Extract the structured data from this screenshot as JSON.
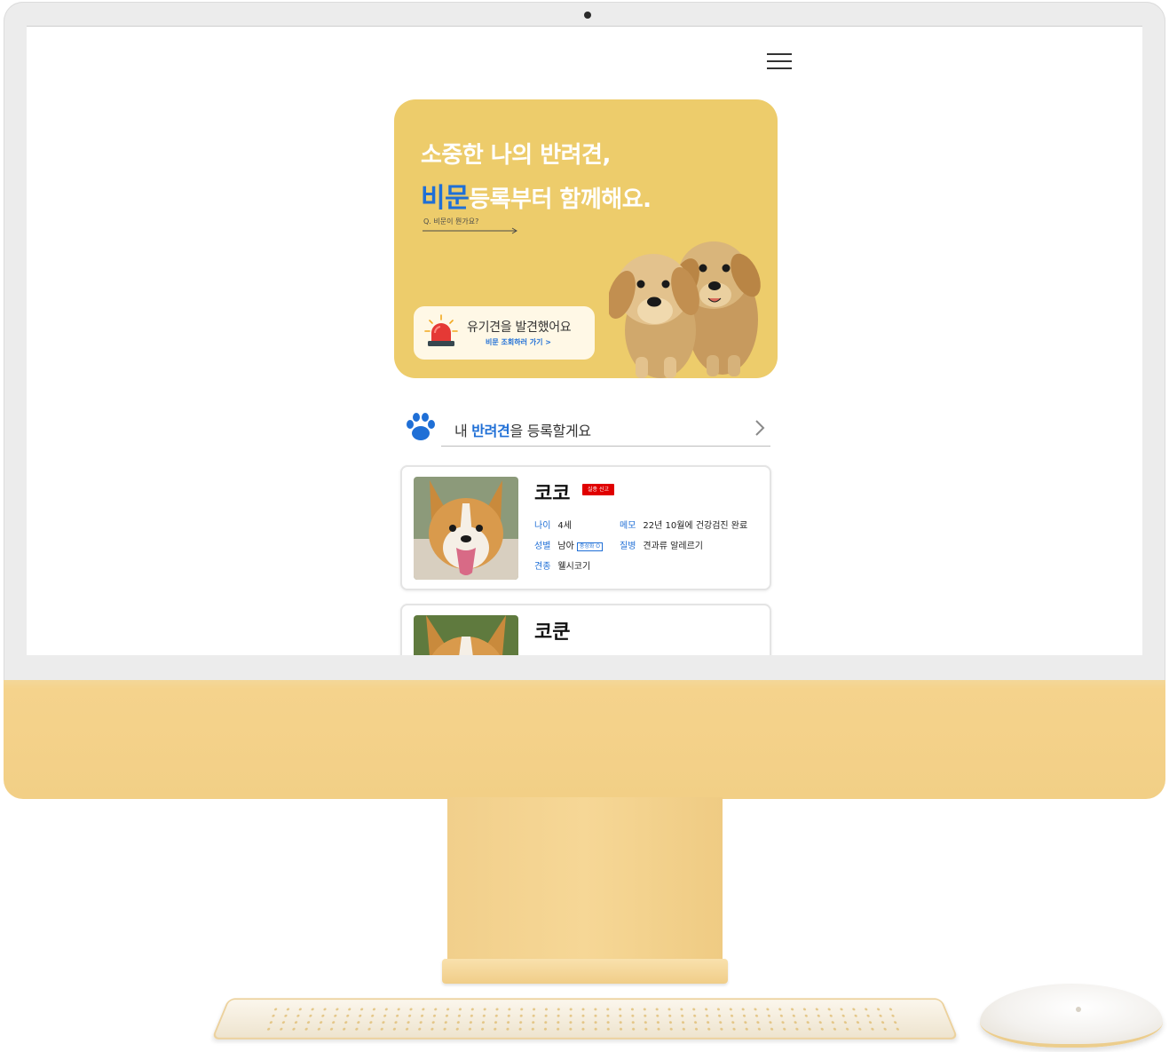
{
  "header": {
    "menu_icon": "hamburger-menu-icon"
  },
  "hero": {
    "line1": "소중한 나의 반려견,",
    "line2_accent": "비문",
    "line2_rest": "등록부터 함께해요.",
    "question_link": "Q. 비문이 뭔가요?",
    "alert": {
      "icon": "siren-icon",
      "title": "유기견을 발견했어요",
      "link": "비문 조회하러 가기 >"
    },
    "image": "golden-retriever-puppies"
  },
  "register": {
    "icon": "paw-icon",
    "prefix": "내 ",
    "accent": "반려견",
    "suffix": "을 등록할게요",
    "chevron_icon": "chevron-right-icon"
  },
  "dogs": [
    {
      "name": "코코",
      "badge": "실종 신고",
      "age_label": "나이",
      "age": "4세",
      "memo_label": "메모",
      "memo": "22년 10월에 건강검진 완료",
      "sex_label": "성별",
      "sex": "남아",
      "neuter": "중성화 O",
      "disease_label": "질병",
      "disease": "견과류 알레르기",
      "breed_label": "견종",
      "breed": "웰시코기",
      "photo": "corgi-photo"
    },
    {
      "name": "코쿤",
      "photo": "corgi-photo"
    }
  ],
  "colors": {
    "accent_blue": "#1f6fd6",
    "hero_yellow": "#edcc6b",
    "badge_red": "#e00000",
    "imac_yellow": "#f5d38c"
  }
}
